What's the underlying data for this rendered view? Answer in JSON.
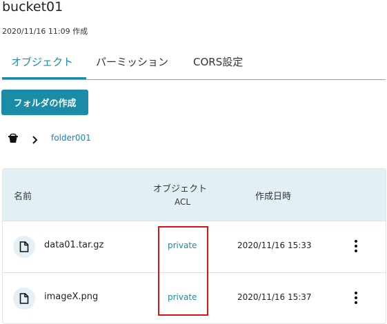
{
  "bucket": {
    "name": "bucket01",
    "created": "2020/11/16 11:09 作成"
  },
  "tabs": [
    {
      "label": "オブジェクト",
      "active": true
    },
    {
      "label": "パーミッション",
      "active": false
    },
    {
      "label": "CORS設定",
      "active": false
    }
  ],
  "actions": {
    "create_folder": "フォルダの作成"
  },
  "breadcrumb": {
    "root_icon": "bucket-icon",
    "separator_icon": "chevron-right-icon",
    "current": "folder001"
  },
  "table": {
    "headers": {
      "name": "名前",
      "acl_line1": "オブジェクト",
      "acl_line2": "ACL",
      "created": "作成日時"
    },
    "rows": [
      {
        "name": "data01.tar.gz",
        "acl": "private",
        "created": "2020/11/16 15:33",
        "icon": "file-icon"
      },
      {
        "name": "imageX.png",
        "acl": "private",
        "created": "2020/11/16 15:37",
        "icon": "file-icon"
      }
    ]
  },
  "colors": {
    "accent": "#1a8ca8",
    "link": "#1a7fc0",
    "header_bg": "#e2f0f5",
    "highlight": "#e01010"
  }
}
